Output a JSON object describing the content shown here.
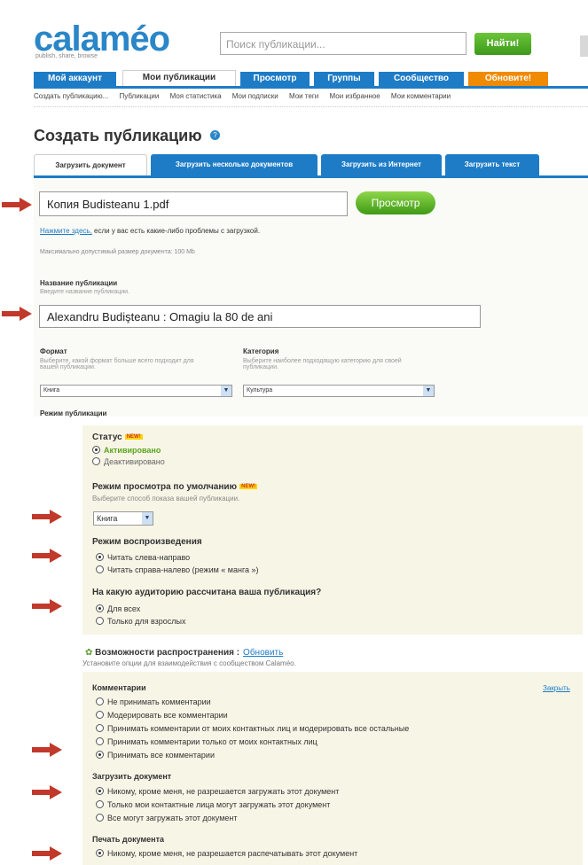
{
  "header": {
    "logo": "calaméo",
    "tagline": "publish, share, browse",
    "search_placeholder": "Поиск публикации...",
    "search_button": "Найти!"
  },
  "nav": {
    "tabs": [
      "Мой аккаунт",
      "Мои публикации",
      "Просмотр",
      "Группы",
      "Сообщество",
      "Обновите!"
    ],
    "active_tab": "Мои публикации",
    "subnav": [
      "Создать публикацию...",
      "Публикации",
      "Моя статистика",
      "Мои подписки",
      "Мои теги",
      "Мои избранное",
      "Мои комментарии"
    ]
  },
  "page": {
    "title": "Создать публикацию"
  },
  "upload": {
    "tabs": [
      "Загрузить документ",
      "Загрузить несколько документов",
      "Загрузить из Интернет",
      "Загрузить текст"
    ],
    "file_value": "Копия Budisteanu 1.pdf",
    "preview_button": "Просмотр",
    "help_link": "Нажмите здесь,",
    "help_text": " если у вас есть какие-либо проблемы с загрузкой.",
    "max_size": "Максимально допустимый размер документа: 100 Mb"
  },
  "form": {
    "name_label": "Название публикации",
    "name_hint": "Введите название публикации.",
    "name_value": "Alexandru Budişteanu : Omagiu la 80 de ani",
    "format_label": "Формат",
    "format_hint": "Выберите, какой формат больше всего подходит для вашей публикации.",
    "format_value": "Книга",
    "category_label": "Категория",
    "category_hint": "Выберите наиболее подходящую категорию для своей публикации.",
    "category_value": "Культура",
    "mode_label": "Режим публикации"
  },
  "settings": {
    "status_label": "Статус",
    "new_badge": "NEW!",
    "status_options": [
      "Активировано",
      "Деактивировано"
    ],
    "view_label": "Режим просмотра по умолчанию",
    "view_hint": "Выберите способ показа вашей публикации.",
    "view_value": "Книга",
    "playback_label": "Режим воспроизведения",
    "playback_options": [
      "Читать слева-направо",
      "Читать справа-налево (режим « манга »)"
    ],
    "audience_label": "На какую аудиторию рассчитана ваша публикация?",
    "audience_options": [
      "Для всех",
      "Только для взрослых"
    ]
  },
  "distribution": {
    "title": "Возможности распространения :",
    "update_link": "Обновить",
    "subtitle": "Установите опции для взаимодействия с сообществом Calaméo.",
    "close_link": "Закрыть",
    "comments_label": "Комментарии",
    "comments_options": [
      "Не принимать комментарии",
      "Модерировать все комментарии",
      "Принимать комментарии от моих контактных лиц и модерировать все остальные",
      "Принимать комментарии только от моих контактных лиц",
      "Принимать все комментарии"
    ],
    "download_label": "Загрузить документ",
    "download_options": [
      "Никому, кроме меня, не разрешается загружать этот документ",
      "Только мои контактные лица могут загружать этот документ",
      "Все могут загружать этот документ"
    ],
    "print_label": "Печать документа",
    "print_options": [
      "Никому, кроме меня, не разрешается распечатывать этот документ"
    ]
  }
}
